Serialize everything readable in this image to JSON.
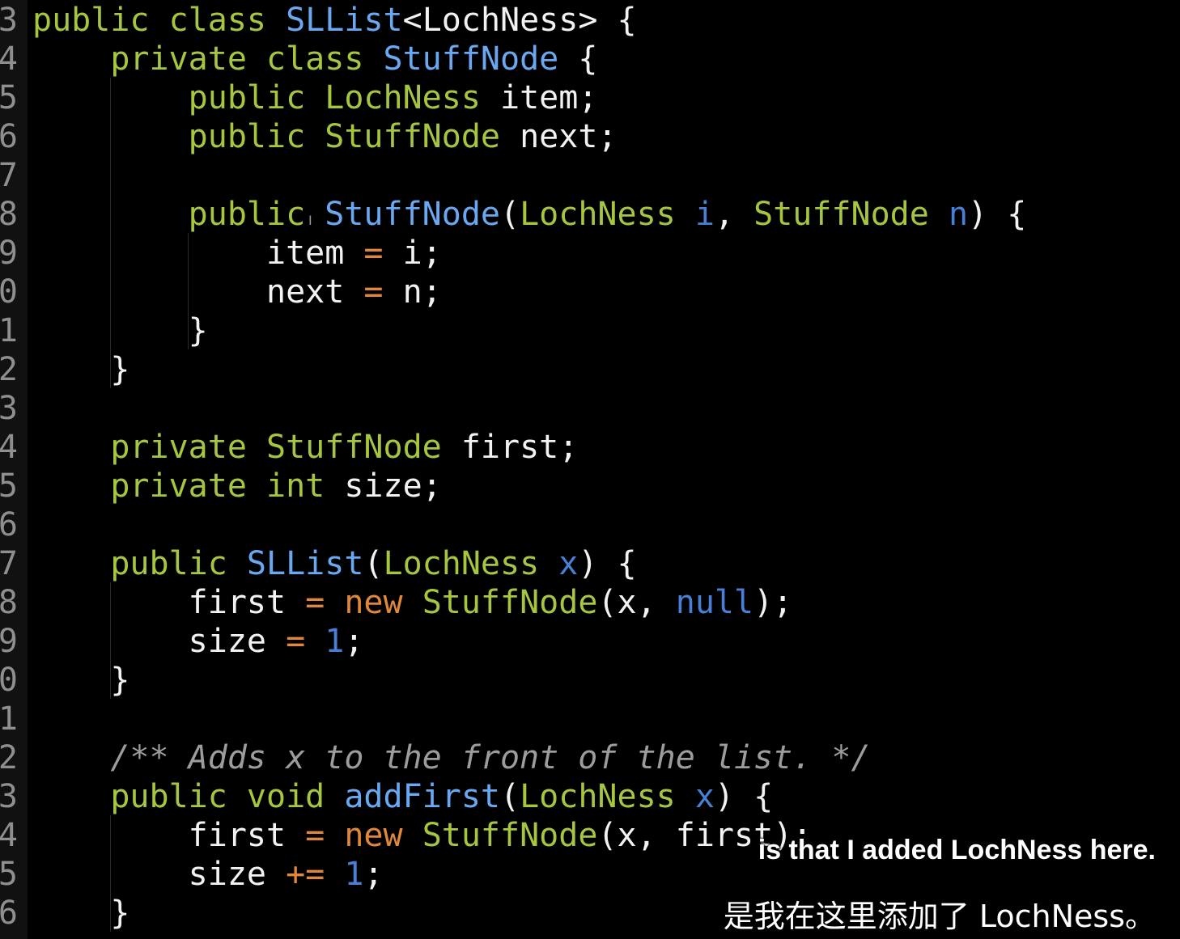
{
  "editor": {
    "lines": [
      {
        "num": "3",
        "tokens": [
          [
            "kw",
            "public"
          ],
          [
            "pl",
            " "
          ],
          [
            "kw",
            "class"
          ],
          [
            "pl",
            " "
          ],
          [
            "cls",
            "SLList"
          ],
          [
            "pl",
            "<LochNess> {"
          ]
        ]
      },
      {
        "num": "4",
        "tokens": [
          [
            "pl",
            "    "
          ],
          [
            "kw",
            "private"
          ],
          [
            "pl",
            " "
          ],
          [
            "kw",
            "class"
          ],
          [
            "pl",
            " "
          ],
          [
            "cls",
            "StuffNode"
          ],
          [
            "pl",
            " {"
          ]
        ]
      },
      {
        "num": "5",
        "tokens": [
          [
            "pl",
            "        "
          ],
          [
            "kw",
            "public"
          ],
          [
            "pl",
            " "
          ],
          [
            "tp",
            "LochNess"
          ],
          [
            "pl",
            " item;"
          ]
        ]
      },
      {
        "num": "6",
        "tokens": [
          [
            "pl",
            "        "
          ],
          [
            "kw",
            "public"
          ],
          [
            "pl",
            " "
          ],
          [
            "tp",
            "StuffNode"
          ],
          [
            "pl",
            " next;"
          ]
        ]
      },
      {
        "num": "7",
        "tokens": []
      },
      {
        "num": "8",
        "tokens": [
          [
            "pl",
            "        "
          ],
          [
            "kw",
            "public"
          ],
          [
            "pl",
            " "
          ],
          [
            "cls",
            "StuffNode"
          ],
          [
            "pl",
            "("
          ],
          [
            "tp",
            "LochNess"
          ],
          [
            "pl",
            " "
          ],
          [
            "param",
            "i"
          ],
          [
            "pl",
            ", "
          ],
          [
            "tp",
            "StuffNode"
          ],
          [
            "pl",
            " "
          ],
          [
            "param",
            "n"
          ],
          [
            "pl",
            ") {"
          ]
        ]
      },
      {
        "num": "9",
        "tokens": [
          [
            "pl",
            "            item "
          ],
          [
            "op",
            "="
          ],
          [
            "pl",
            " i;"
          ]
        ]
      },
      {
        "num": "0",
        "tokens": [
          [
            "pl",
            "            next "
          ],
          [
            "op",
            "="
          ],
          [
            "pl",
            " n;"
          ]
        ]
      },
      {
        "num": "1",
        "tokens": [
          [
            "pl",
            "        }"
          ]
        ]
      },
      {
        "num": "2",
        "tokens": [
          [
            "pl",
            "    }"
          ]
        ]
      },
      {
        "num": "3",
        "tokens": []
      },
      {
        "num": "4",
        "tokens": [
          [
            "pl",
            "    "
          ],
          [
            "kw",
            "private"
          ],
          [
            "pl",
            " "
          ],
          [
            "tp",
            "StuffNode"
          ],
          [
            "pl",
            " first;"
          ]
        ]
      },
      {
        "num": "5",
        "tokens": [
          [
            "pl",
            "    "
          ],
          [
            "kw",
            "private"
          ],
          [
            "pl",
            " "
          ],
          [
            "tp",
            "int"
          ],
          [
            "pl",
            " size;"
          ]
        ]
      },
      {
        "num": "6",
        "tokens": []
      },
      {
        "num": "7",
        "tokens": [
          [
            "pl",
            "    "
          ],
          [
            "kw",
            "public"
          ],
          [
            "pl",
            " "
          ],
          [
            "cls",
            "SLList"
          ],
          [
            "pl",
            "("
          ],
          [
            "tp",
            "LochNess"
          ],
          [
            "pl",
            " "
          ],
          [
            "param",
            "x"
          ],
          [
            "pl",
            ") {"
          ]
        ]
      },
      {
        "num": "8",
        "tokens": [
          [
            "pl",
            "        first "
          ],
          [
            "op",
            "="
          ],
          [
            "pl",
            " "
          ],
          [
            "new",
            "new"
          ],
          [
            "pl",
            " "
          ],
          [
            "tp",
            "StuffNode"
          ],
          [
            "pl",
            "(x, "
          ],
          [
            "num",
            "null"
          ],
          [
            "pl",
            ");"
          ]
        ]
      },
      {
        "num": "9",
        "tokens": [
          [
            "pl",
            "        size "
          ],
          [
            "op",
            "="
          ],
          [
            "pl",
            " "
          ],
          [
            "num",
            "1"
          ],
          [
            "pl",
            ";"
          ]
        ]
      },
      {
        "num": "0",
        "tokens": [
          [
            "pl",
            "    }"
          ]
        ]
      },
      {
        "num": "1",
        "tokens": []
      },
      {
        "num": "2",
        "tokens": [
          [
            "pl",
            "    "
          ],
          [
            "cmt",
            "/** Adds x to the front of the list. */"
          ]
        ]
      },
      {
        "num": "3",
        "tokens": [
          [
            "pl",
            "    "
          ],
          [
            "kw",
            "public"
          ],
          [
            "pl",
            " "
          ],
          [
            "kw",
            "void"
          ],
          [
            "pl",
            " "
          ],
          [
            "cls",
            "addFirst"
          ],
          [
            "pl",
            "("
          ],
          [
            "tp",
            "LochNess"
          ],
          [
            "pl",
            " "
          ],
          [
            "param",
            "x"
          ],
          [
            "pl",
            ") {"
          ]
        ]
      },
      {
        "num": "4",
        "tokens": [
          [
            "pl",
            "        first "
          ],
          [
            "op",
            "="
          ],
          [
            "pl",
            " "
          ],
          [
            "new",
            "new"
          ],
          [
            "pl",
            " "
          ],
          [
            "tp",
            "StuffNode"
          ],
          [
            "pl",
            "(x, first);"
          ]
        ]
      },
      {
        "num": "5",
        "tokens": [
          [
            "pl",
            "        size "
          ],
          [
            "op",
            "+="
          ],
          [
            "pl",
            " "
          ],
          [
            "num",
            "1"
          ],
          [
            "pl",
            ";"
          ]
        ]
      },
      {
        "num": "6",
        "tokens": [
          [
            "pl",
            "    }"
          ]
        ]
      }
    ]
  },
  "subtitles": {
    "english": "is that I added LochNess here.",
    "chinese": "是我在这里添加了 LochNess。"
  },
  "colors": {
    "background": "#000000",
    "keyword": "#a6c63f",
    "class_name": "#6aa9f2",
    "parameter": "#4a7fd6",
    "operator": "#e0873a",
    "plain": "#f2f2f2",
    "comment": "#9c9c9c",
    "line_number": "#8f8f8f"
  },
  "icons": {
    "text_cursor": "I"
  }
}
